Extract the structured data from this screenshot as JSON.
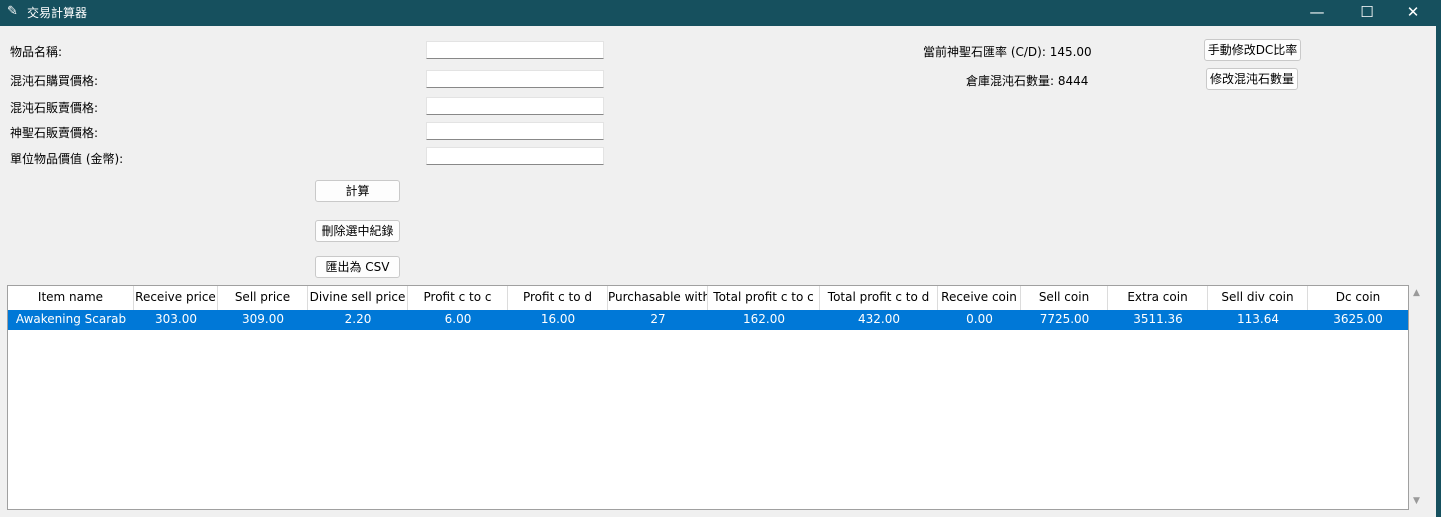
{
  "window": {
    "title": "交易計算器",
    "minimize_glyph": "—",
    "maximize_glyph": "☐",
    "close_glyph": "✕",
    "titlebar_color": "#16505e"
  },
  "form": {
    "item_name_label": "物品名稱:",
    "chaos_buy_label": "混沌石購買價格:",
    "chaos_sell_label": "混沌石販賣價格:",
    "divine_sell_label": "神聖石販賣價格:",
    "unit_value_label": "單位物品價值 (金幣):",
    "item_name_value": "",
    "chaos_buy_value": "",
    "chaos_sell_value": "",
    "divine_sell_value": "",
    "unit_value_value": ""
  },
  "actions": {
    "calculate": "計算",
    "delete_selected": "刪除選中紀錄",
    "export_csv": "匯出為 CSV"
  },
  "info": {
    "dc_rate_text": "當前神聖石匯率 (C/D): 145.00",
    "chaos_count_text": "倉庫混沌石數量: 8444",
    "edit_dc_button": "手動修改DC比率",
    "edit_chaos_button": "修改混沌石數量"
  },
  "table": {
    "columns": [
      "Item name",
      "Receive price",
      "Sell price",
      "Divine sell price",
      "Profit c to c",
      "Profit c to d",
      "Purchasable with",
      "Total profit c to c",
      "Total profit c to d",
      "Receive coin",
      "Sell coin",
      "Extra coin",
      "Sell div coin",
      "Dc coin"
    ],
    "rows": [
      [
        "Awakening Scarab",
        "303.00",
        "309.00",
        "2.20",
        "6.00",
        "16.00",
        "27",
        "162.00",
        "432.00",
        "0.00",
        "7725.00",
        "3511.36",
        "113.64",
        "3625.00"
      ]
    ],
    "selected_row_color": "#0078d7"
  }
}
